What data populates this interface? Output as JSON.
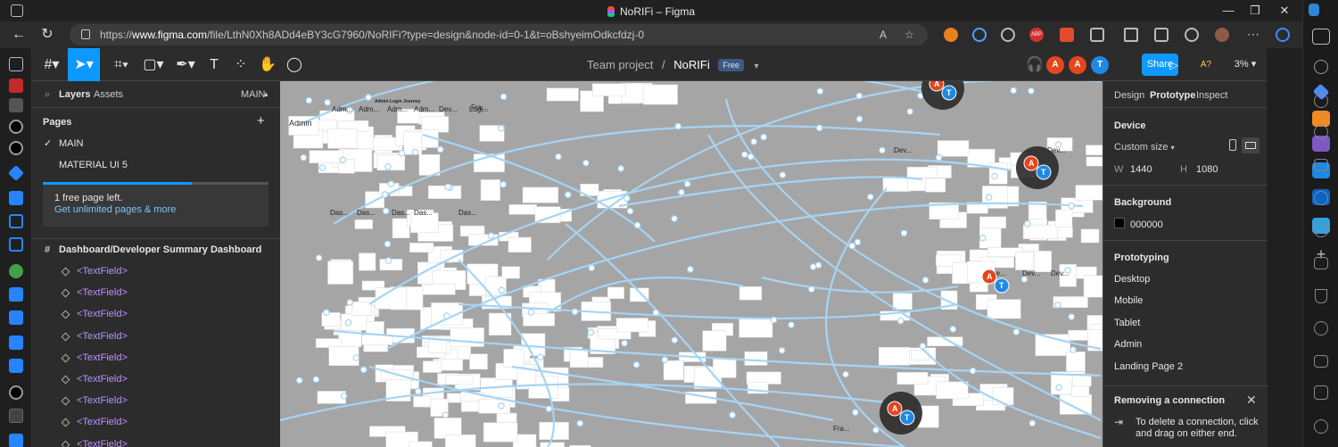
{
  "browser": {
    "window_title": "NoRIFi – Figma",
    "url_prefix": "https://",
    "url_host": "www.figma.com",
    "url_path": "/file/LthN0Xh8ADd4eBY3cG7960/NoRIFi?type=design&node-id=0-1&t=oBshyeimOdkcfdzj-0",
    "reader_label": "A",
    "ext_abp": "ABP"
  },
  "toolbar": {
    "project": "Team project",
    "separator": "/",
    "file_name": "NoRIFi",
    "plan_badge": "Free",
    "avatars": [
      {
        "letter": "A",
        "color": "#e4461e"
      },
      {
        "letter": "A",
        "color": "#e4461e"
      },
      {
        "letter": "T",
        "color": "#1e88e5"
      }
    ],
    "share_label": "Share",
    "a11y_label": "A?",
    "zoom": "3%"
  },
  "layers_panel": {
    "tab_layers": "Layers",
    "tab_assets": "Assets",
    "page_switch": "MAIN",
    "pages_header": "Pages",
    "add_page": "+",
    "pages": [
      {
        "name": "MAIN",
        "selected": true
      },
      {
        "name": "MATERIAL UI 5",
        "selected": false
      }
    ],
    "upgrade_line1": "1 free page left.",
    "upgrade_line2": "Get unlimited pages & more",
    "frame_name": "Dashboard/Developer Summary Dashboard",
    "layers": [
      "<TextField>",
      "<TextField>",
      "<TextField>",
      "<TextField>",
      "<TextField>",
      "<TextField>",
      "<TextField>",
      "<TextField>",
      "<TextField>"
    ]
  },
  "canvas": {
    "label_admin": "Admin",
    "label_journey": "Admin Login Journey",
    "frame_labels": [
      "Adm...",
      "Adm...",
      "Adm...",
      "Adm...",
      "Dev...",
      "Logi...",
      "Fra...",
      "Das...",
      "Das...",
      "Das...",
      "Das...",
      "Das...",
      "Dev...",
      "Dev...",
      "Inve...",
      "Dev...",
      "Dev...",
      "Fra..."
    ],
    "cursors": [
      {
        "a": "A",
        "t": "T"
      },
      {
        "a": "A",
        "t": "T"
      },
      {
        "a": "A",
        "t": "T"
      },
      {
        "a": "A",
        "t": "T"
      }
    ]
  },
  "properties": {
    "tabs": [
      "Design",
      "Prototype",
      "Inspect"
    ],
    "active_tab": "Prototype",
    "device_header": "Device",
    "device_value": "Custom size",
    "w_label": "W",
    "w_value": "1440",
    "h_label": "H",
    "h_value": "1080",
    "background_header": "Background",
    "background_value": "000000",
    "background_color": "#000000",
    "prototyping_header": "Prototyping",
    "flows": [
      "Desktop",
      "Mobile",
      "Tablet",
      "Admin",
      "Landing Page 2"
    ],
    "toast_title": "Removing a connection",
    "toast_body": "To delete a connection, click and drag on either end."
  },
  "colors": {
    "accent": "#0d99ff",
    "canvas_bg": "#a5a5a5",
    "connector": "#a6d4f5",
    "panel_bg": "#2c2c2c"
  }
}
